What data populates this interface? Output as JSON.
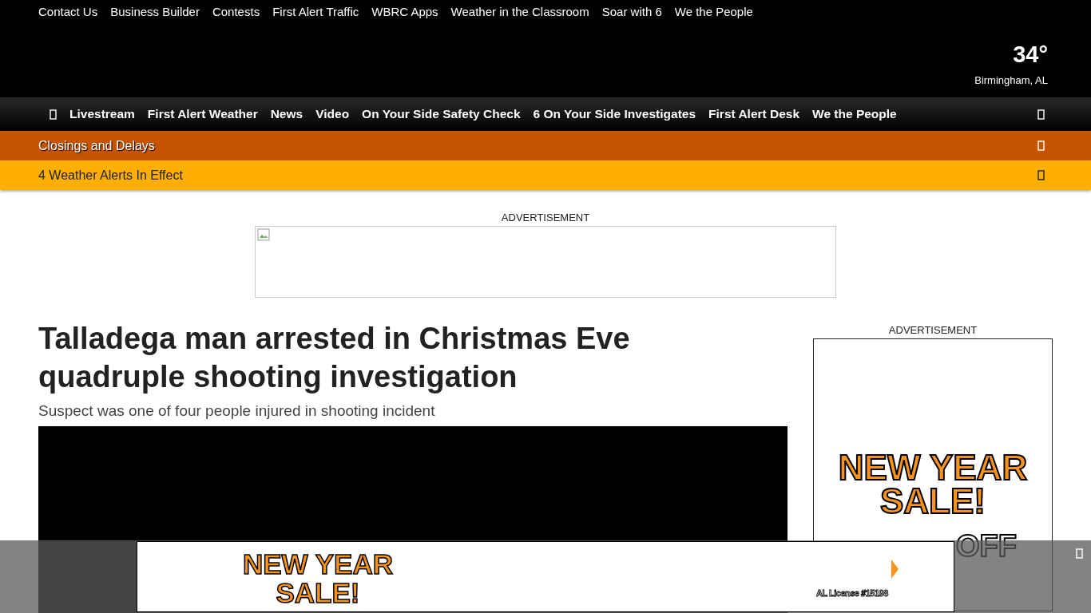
{
  "top_links": [
    "Contact Us",
    "Business Builder",
    "Contests",
    "First Alert Traffic",
    "WBRC Apps",
    "Weather in the Classroom",
    "Soar with 6",
    "We the People"
  ],
  "weather": {
    "temperature": "34°",
    "location": "Birmingham, AL"
  },
  "nav": {
    "items": [
      "Livestream",
      "First Alert Weather",
      "News",
      "Video",
      "On Your Side Safety Check",
      "6 On Your Side Investigates",
      "First Alert Desk",
      "We the People"
    ]
  },
  "alerts": [
    {
      "kind": "closings",
      "label": "Closings and Delays"
    },
    {
      "kind": "weather",
      "label": "4 Weather Alerts In Effect"
    }
  ],
  "top_ad": {
    "label": "ADVERTISEMENT"
  },
  "article": {
    "headline": "Talladega man arrested in Christmas Eve quadruple shooting investigation",
    "subheadline": "Suspect was one of four people injured in shooting incident"
  },
  "side_ad": {
    "label": "ADVERTISEMENT",
    "headline_lines": [
      "NEW YEAR",
      "SALE!"
    ],
    "offer": "OFF"
  },
  "bottom_ad": {
    "headline_lines": [
      "NEW YEAR",
      "SALE!"
    ],
    "license": "AL License #15198"
  }
}
